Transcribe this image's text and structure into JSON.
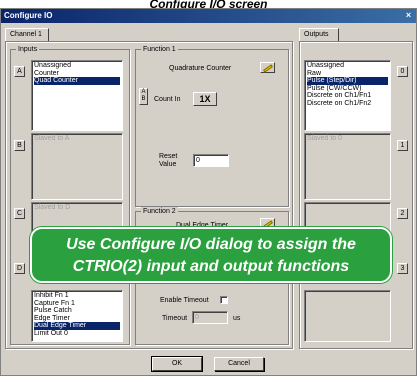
{
  "caption": "Configure I/O screen",
  "window": {
    "title": "Configure IO",
    "close_glyph": "×"
  },
  "tabs": {
    "channel": "Channel 1",
    "outputs": "Outputs"
  },
  "inputs": {
    "label": "Inputs",
    "a": {
      "letter": "A",
      "items": [
        {
          "text": "Unassigned",
          "selected": false
        },
        {
          "text": "Counter",
          "selected": false
        },
        {
          "text": "Quad Counter",
          "selected": true
        }
      ]
    },
    "b": {
      "letter": "B",
      "slaved": "Slaved to A"
    },
    "c": {
      "letter": "C",
      "slaved": "Slaved to D"
    },
    "d": {
      "letter": "D",
      "items": [
        {
          "text": "Inhibit Fn 1",
          "selected": false
        },
        {
          "text": "Capture Fn 1",
          "selected": false
        },
        {
          "text": "Pulse Catch",
          "selected": false
        },
        {
          "text": "Edge Timer",
          "selected": false
        },
        {
          "text": "Dual Edge Timer",
          "selected": true
        },
        {
          "text": "Limit Out 0",
          "selected": false
        }
      ]
    }
  },
  "function1": {
    "label": "Function 1",
    "mode": "Quadrature Counter",
    "ab_top": "A",
    "ab_bottom": "B",
    "count_in_label": "Count In",
    "count_in_value": "1X",
    "reset_label_line1": "Reset",
    "reset_label_line2": "Value",
    "reset_value": "0"
  },
  "function2": {
    "label": "Function 2",
    "mode": "Dual Edge Timer",
    "enable_timeout_label": "Enable Timeout",
    "timeout_label": "Timeout",
    "timeout_value": "0",
    "timeout_unit": "us"
  },
  "outputs": {
    "o0": {
      "number": "0",
      "items": [
        {
          "text": "Unassigned",
          "selected": false
        },
        {
          "text": "Raw",
          "selected": false
        },
        {
          "text": "Pulse (Step/Dir)",
          "selected": true
        },
        {
          "text": "Pulse (CW/CCW)",
          "selected": false
        },
        {
          "text": "Discrete on Ch1/Fn1",
          "selected": false
        },
        {
          "text": "Discrete on Ch1/Fn2",
          "selected": false
        }
      ]
    },
    "o1": {
      "number": "1",
      "slaved": "Slaved to 0"
    },
    "o2": {
      "number": "2"
    },
    "o3": {
      "number": "3"
    }
  },
  "buttons": {
    "ok": "OK",
    "cancel": "Cancel"
  },
  "banner": {
    "line1": "Use Configure I/O dialog to assign the",
    "line2": "CTRIO(2) input and output functions"
  },
  "colors": {
    "selection": "#0a246a",
    "titlebar": "#0a246a",
    "banner": "#2aa13e"
  },
  "icons": {
    "configure": "pencil-icon",
    "close": "close-icon"
  }
}
